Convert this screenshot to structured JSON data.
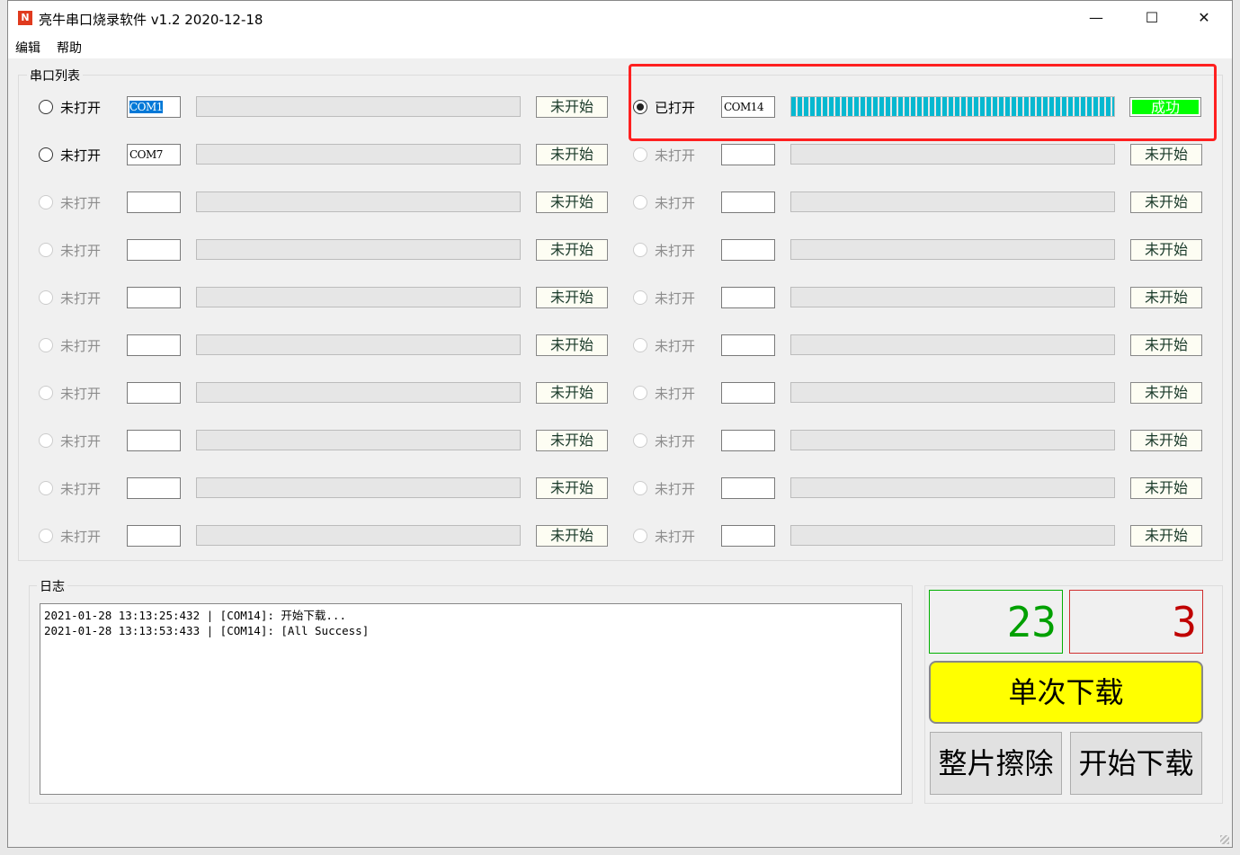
{
  "window": {
    "title": "亮牛串口烧录软件 v1.2 2020-12-18",
    "minimize": "—",
    "maximize": "☐",
    "close": "✕"
  },
  "menu": [
    {
      "label": "编辑"
    },
    {
      "label": "帮助"
    }
  ],
  "ports_group": {
    "label": "串口列表"
  },
  "ports_left": [
    {
      "status": "未打开",
      "port": "COM1",
      "selected_text": true,
      "enabled": true,
      "checked": false,
      "progress": 0,
      "button": "未开始"
    },
    {
      "status": "未打开",
      "port": "COM7",
      "enabled": true,
      "checked": false,
      "progress": 0,
      "button": "未开始"
    },
    {
      "status": "未打开",
      "port": "",
      "enabled": false,
      "checked": false,
      "progress": 0,
      "button": "未开始"
    },
    {
      "status": "未打开",
      "port": "",
      "enabled": false,
      "checked": false,
      "progress": 0,
      "button": "未开始"
    },
    {
      "status": "未打开",
      "port": "",
      "enabled": false,
      "checked": false,
      "progress": 0,
      "button": "未开始"
    },
    {
      "status": "未打开",
      "port": "",
      "enabled": false,
      "checked": false,
      "progress": 0,
      "button": "未开始"
    },
    {
      "status": "未打开",
      "port": "",
      "enabled": false,
      "checked": false,
      "progress": 0,
      "button": "未开始"
    },
    {
      "status": "未打开",
      "port": "",
      "enabled": false,
      "checked": false,
      "progress": 0,
      "button": "未开始"
    },
    {
      "status": "未打开",
      "port": "",
      "enabled": false,
      "checked": false,
      "progress": 0,
      "button": "未开始"
    },
    {
      "status": "未打开",
      "port": "",
      "enabled": false,
      "checked": false,
      "progress": 0,
      "button": "未开始"
    }
  ],
  "ports_right": [
    {
      "status": "已打开",
      "port": "COM14",
      "enabled": true,
      "checked": true,
      "progress": 100,
      "button": "成功",
      "success": true
    },
    {
      "status": "未打开",
      "port": "",
      "enabled": false,
      "checked": false,
      "progress": 0,
      "button": "未开始"
    },
    {
      "status": "未打开",
      "port": "",
      "enabled": false,
      "checked": false,
      "progress": 0,
      "button": "未开始"
    },
    {
      "status": "未打开",
      "port": "",
      "enabled": false,
      "checked": false,
      "progress": 0,
      "button": "未开始"
    },
    {
      "status": "未打开",
      "port": "",
      "enabled": false,
      "checked": false,
      "progress": 0,
      "button": "未开始"
    },
    {
      "status": "未打开",
      "port": "",
      "enabled": false,
      "checked": false,
      "progress": 0,
      "button": "未开始"
    },
    {
      "status": "未打开",
      "port": "",
      "enabled": false,
      "checked": false,
      "progress": 0,
      "button": "未开始"
    },
    {
      "status": "未打开",
      "port": "",
      "enabled": false,
      "checked": false,
      "progress": 0,
      "button": "未开始"
    },
    {
      "status": "未打开",
      "port": "",
      "enabled": false,
      "checked": false,
      "progress": 0,
      "button": "未开始"
    },
    {
      "status": "未打开",
      "port": "",
      "enabled": false,
      "checked": false,
      "progress": 0,
      "button": "未开始"
    }
  ],
  "log": {
    "label": "日志",
    "lines": [
      "2021-01-28 13:13:25:432 | [COM14]: 开始下载...",
      "2021-01-28 13:13:53:433 | [COM14]: [All Success]"
    ]
  },
  "counters": {
    "success": "23",
    "fail": "3",
    "success_color": "#00a000",
    "fail_color": "#c00000"
  },
  "buttons": {
    "single_download": "单次下载",
    "erase_chip": "整片擦除",
    "start_download": "开始下载"
  },
  "colors": {
    "progress": "#06b8d0",
    "success_button": "#00ff00",
    "single_download_bg": "#ffff00",
    "annotation": "#ff2020"
  }
}
